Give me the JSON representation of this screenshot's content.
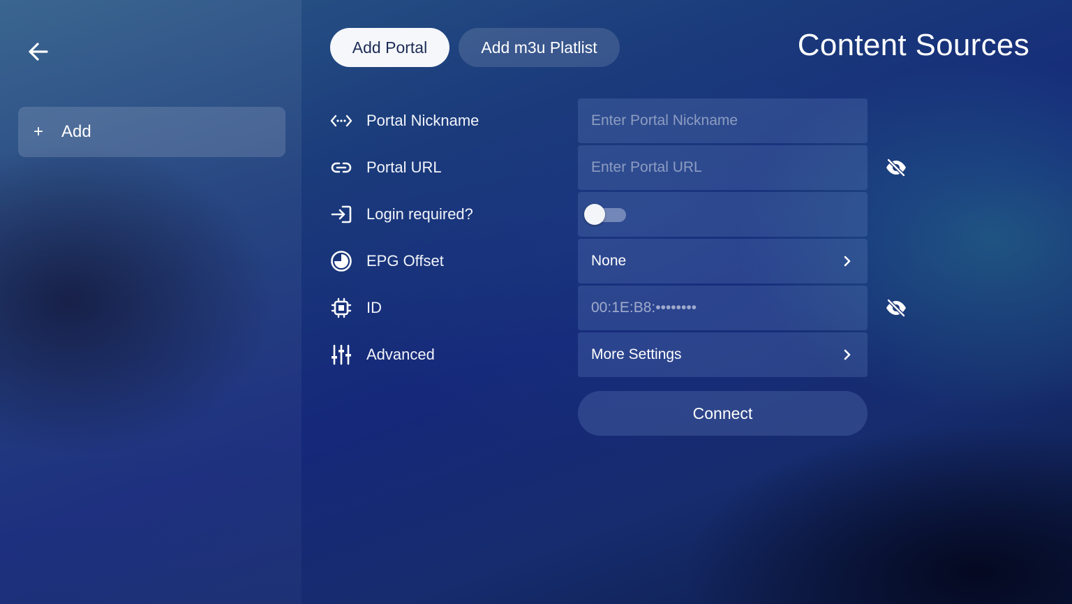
{
  "header": {
    "title": "Content Sources",
    "tabs": [
      {
        "label": "Add Portal",
        "active": true
      },
      {
        "label": "Add m3u Platlist",
        "active": false
      }
    ]
  },
  "sidebar": {
    "add_label": "Add",
    "add_symbol": "+"
  },
  "form": {
    "nickname": {
      "label": "Portal Nickname",
      "placeholder": "Enter Portal Nickname",
      "value": ""
    },
    "url": {
      "label": "Portal URL",
      "placeholder": "Enter Portal URL",
      "value": ""
    },
    "login": {
      "label": "Login required?",
      "enabled": false
    },
    "epg_offset": {
      "label": "EPG Offset",
      "value": "None"
    },
    "id": {
      "label": "ID",
      "value": "00:1E:B8:••••••••"
    },
    "advanced": {
      "label": "Advanced",
      "value": "More Settings"
    }
  },
  "connect_label": "Connect",
  "icons": {
    "back": "arrow-left-icon",
    "nickname": "code-arrows-icon",
    "url": "link-icon",
    "login": "login-arrow-icon",
    "epg": "clock-half-icon",
    "id": "chip-icon",
    "advanced": "sliders-icon",
    "visibility": "eye-off-icon",
    "chevron": "chevron-right-icon"
  },
  "colors": {
    "active_tab_bg": "#f6f7fb",
    "active_tab_text": "#1c2c55",
    "field_bg": "rgba(120,150,210,0.22)"
  }
}
